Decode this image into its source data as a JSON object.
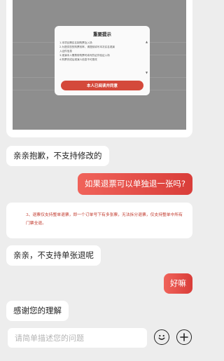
{
  "image_message": {
    "modal": {
      "title": "重要提示",
      "lines": [
        "1.本项目需实名制购票及入场",
        "2.为提供您的购票效率，请提前填写本次实名观演",
        "入证件信息",
        "3.观演本人需携带购票时填写的证件验证入场",
        "4.购票完成后观演人信息不可更改"
      ],
      "confirm_label": "本人已阅读并同意"
    }
  },
  "messages": [
    {
      "side": "left",
      "text": "亲亲抱歉，不支持修改的"
    },
    {
      "side": "right",
      "text": "如果退票可以单独退一张吗?"
    },
    {
      "side": "left",
      "notice": "3、退票仅支持整单退票，即一个订单号下有多张票，无法拆分退票，仅支持整单中所有门票全退。"
    },
    {
      "side": "left",
      "text": "亲亲，不支持单张退呢"
    },
    {
      "side": "right",
      "text": "好嘛"
    },
    {
      "side": "left",
      "text": "感谢您的理解"
    }
  ],
  "input": {
    "placeholder": "请简单描述您的问题",
    "value": ""
  },
  "icons": {
    "emoji": "smile-icon",
    "more": "plus-icon"
  },
  "colors": {
    "accent": "#e24a44",
    "notice_text": "#c0382b",
    "background": "#ededed"
  }
}
